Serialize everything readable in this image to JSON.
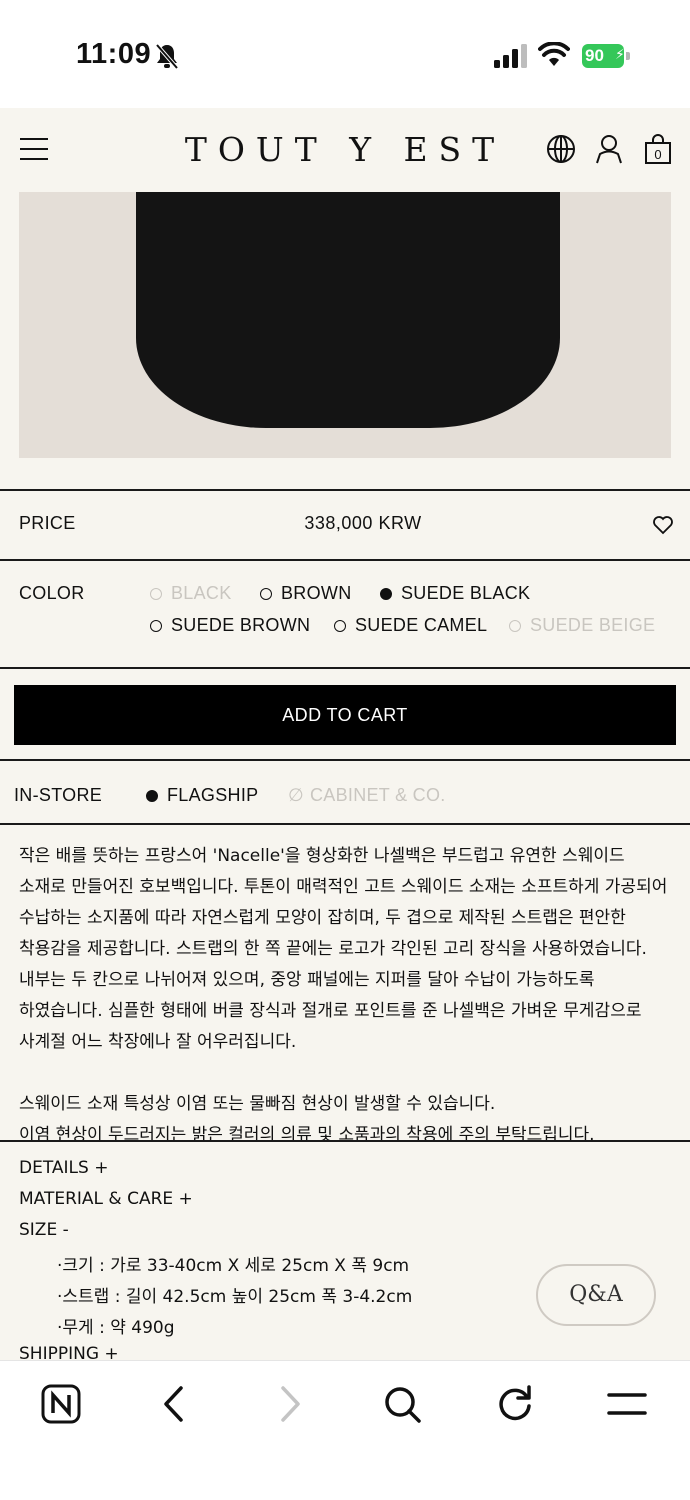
{
  "status_bar": {
    "time": "11:09",
    "battery": "90",
    "icons": [
      "bell-slash-icon",
      "signal-icon",
      "wifi-icon",
      "battery-charging-icon"
    ]
  },
  "header": {
    "logo": "TOUT Y EST",
    "icons": [
      "menu-icon",
      "globe-icon",
      "user-icon",
      "cart-bag-icon"
    ],
    "cart_count": "0"
  },
  "product": {
    "price_label": "PRICE",
    "price_value": "338,000 KRW",
    "color_label": "COLOR",
    "colors": [
      {
        "name": "BLACK",
        "state": "disabled"
      },
      {
        "name": "BROWN",
        "state": "available"
      },
      {
        "name": "SUEDE BLACK",
        "state": "selected"
      },
      {
        "name": "SUEDE BROWN",
        "state": "available"
      },
      {
        "name": "SUEDE CAMEL",
        "state": "available"
      },
      {
        "name": "SUEDE BEIGE",
        "state": "disabled"
      }
    ],
    "add_to_cart": "ADD TO CART",
    "instore_label": "IN-STORE",
    "stores": [
      {
        "name": "FLAGSHIP",
        "state": "selected"
      },
      {
        "name": "CABINET & CO.",
        "state": "unavailable"
      }
    ],
    "description": [
      "작은 배를 뜻하는 프랑스어 'Nacelle'을 형상화한 나셀백은 부드럽고 유연한 스웨이드 소재로 만들어진 호보백입니다. 투톤이 매력적인 고트 스웨이드 소재는 소프트하게 가공되어 수납하는 소지품에 따라 자연스럽게 모양이 잡히며, 두 겹으로 제작된 스트랩은 편안한 착용감을 제공합니다. 스트랩의 한 쪽 끝에는 로고가 각인된 고리 장식을 사용하였습니다. 내부는 두 칸으로 나뉘어져 있으며, 중앙 패널에는 지퍼를 달아 수납이 가능하도록 하였습니다. 심플한 형태에 버클 장식과 절개로 포인트를 준 나셀백은 가벼운 무게감으로 사계절 어느 착장에나 잘 어우러집니다.",
      "스웨이드 소재 특성상 이염 또는 물빠짐 현상이 발생할 수 있습니다.",
      "이염 현상이 두드러지는 밝은 컬러의 의류 및 소품과의 착용에 주의 부탁드립니다."
    ],
    "details": "DETAILS +",
    "material_care": "MATERIAL & CARE +",
    "size": "SIZE -",
    "size_lines": [
      "·크기 : 가로 33-40cm X 세로 25cm X 폭 9cm",
      "·스트랩 : 길이 42.5cm 높이 25cm 폭 3-4.2cm",
      "·무게 : 약 490g"
    ],
    "shipping": "SHIPPING +"
  },
  "qa_button": "Q&A",
  "browser_bar": {
    "icons": [
      "naver-home-icon",
      "back-arrow-icon",
      "forward-arrow-icon",
      "search-icon",
      "refresh-icon",
      "hamburger-menu-icon"
    ]
  }
}
